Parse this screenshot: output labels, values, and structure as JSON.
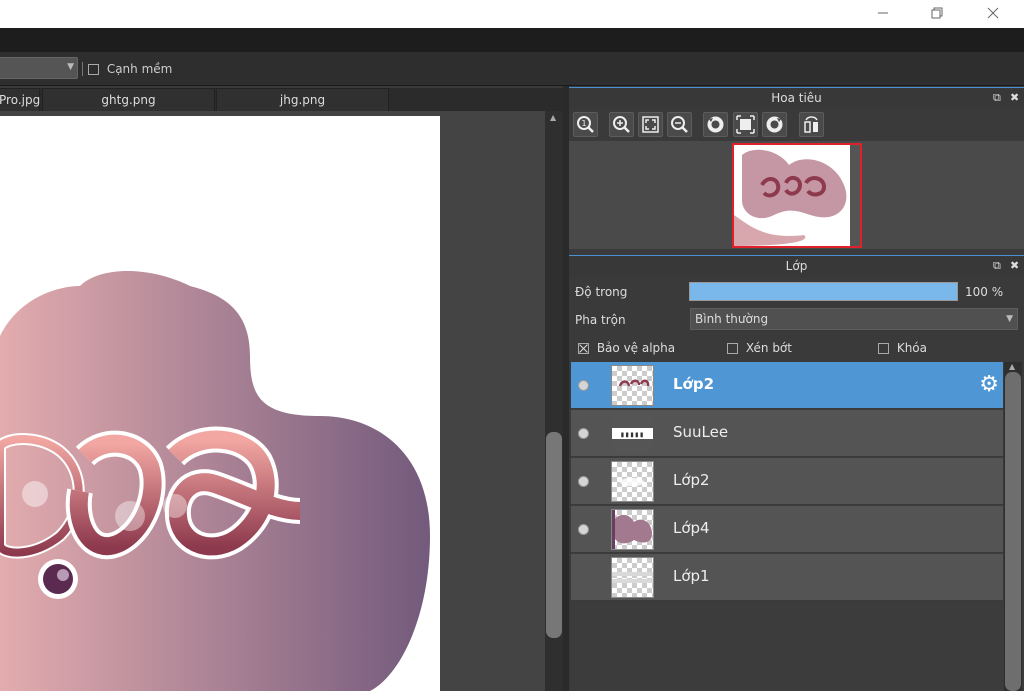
{
  "window": {
    "minimize_icon": "minimize-icon",
    "restore_icon": "restore-icon",
    "close_icon": "close-icon"
  },
  "toolbar": {
    "antialias_label": "Cạnh mềm",
    "antialias_checked": false
  },
  "tabs": [
    {
      "label": "Pro.jpg"
    },
    {
      "label": "ghtg.png"
    },
    {
      "label": "jhg.png"
    }
  ],
  "navigator": {
    "title": "Hoa tiêu",
    "tools": [
      "zoom-actual-icon",
      "zoom-in-icon",
      "fit-window-icon",
      "zoom-out-icon",
      "rotate-left-icon",
      "fit-screen-icon",
      "rotate-right-icon",
      "flip-icon"
    ]
  },
  "layers_panel": {
    "title": "Lớp",
    "opacity_label": "Độ trong",
    "opacity_value": "100 %",
    "opacity_fraction": 1.0,
    "blend_label": "Pha trộn",
    "blend_value": "Bình thường",
    "protect_alpha_label": "Bảo vệ alpha",
    "protect_alpha_checked": true,
    "clipping_label": "Xén bớt",
    "clipping_checked": false,
    "lock_label": "Khóa",
    "lock_checked": false,
    "layers": [
      {
        "name": "Lớp2",
        "visible": true,
        "selected": true
      },
      {
        "name": "SuuLee",
        "visible": true,
        "selected": false
      },
      {
        "name": "Lớp2",
        "visible": true,
        "selected": false
      },
      {
        "name": "Lớp4",
        "visible": true,
        "selected": false
      },
      {
        "name": "Lớp1",
        "visible": false,
        "selected": false
      }
    ]
  },
  "colors": {
    "accent": "#4f97d4",
    "selection_border": "#e0202a",
    "cloud_light": "#e3acae",
    "cloud_dark": "#735a7c"
  }
}
